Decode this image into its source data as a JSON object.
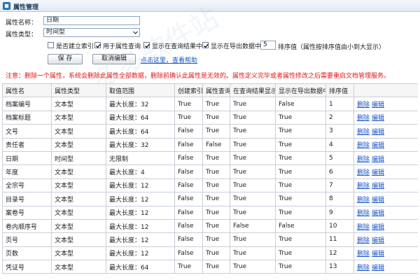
{
  "window": {
    "title": "属性管理"
  },
  "form": {
    "name_label": "属性名称：",
    "name_value": "日期",
    "type_label": "属性类型：",
    "type_value": "时间型",
    "options": [
      {
        "label": "是否建立索引",
        "checked": false
      },
      {
        "label": "用于属性查询",
        "checked": true
      },
      {
        "label": "显示在查询结果中",
        "checked": true
      },
      {
        "label": "显示在导出数据中",
        "checked": true
      }
    ],
    "order_value": "5",
    "order_label": "排序值（属性按排序值由小到大显示）",
    "save_label": "保 存",
    "cancel_label": "取消编辑",
    "help_link": "点击这里，查看帮助"
  },
  "notice": "注意：删除一个属性，系统会删除此属性全部数据，删除前确认此属性是无效的。属性定义完毕或者属性修改之后需要重启文档管理服务。",
  "table": {
    "columns": [
      "属性名",
      "属性类型",
      "取值范围",
      "创建索引",
      "属性查询",
      "在查询结果显示",
      "显示在导出数据中",
      "排序值",
      ""
    ],
    "actions": {
      "delete": "删除",
      "edit": "编辑"
    },
    "rows": [
      [
        "档案编号",
        "文本型",
        "最大长度：32",
        "True",
        "True",
        "True",
        "False",
        "1"
      ],
      [
        "档案标题",
        "文本型",
        "最大长度：64",
        "True",
        "True",
        "True",
        "True",
        "2"
      ],
      [
        "文号",
        "文本型",
        "最大长度：64",
        "False",
        "True",
        "True",
        "True",
        "3"
      ],
      [
        "责任者",
        "文本型",
        "最大长度：32",
        "False",
        "False",
        "True",
        "True",
        "4"
      ],
      [
        "日期",
        "时间型",
        "无限制",
        "False",
        "True",
        "True",
        "True",
        "5"
      ],
      [
        "年度",
        "文本型",
        "最大长度：4",
        "False",
        "True",
        "True",
        "True",
        "6"
      ],
      [
        "全宗号",
        "文本型",
        "最大长度：12",
        "False",
        "True",
        "True",
        "True",
        "7"
      ],
      [
        "目录号",
        "文本型",
        "最大长度：12",
        "False",
        "True",
        "True",
        "True",
        "8"
      ],
      [
        "案卷号",
        "文本型",
        "最大长度：12",
        "False",
        "True",
        "True",
        "True",
        "9"
      ],
      [
        "卷内顺序号",
        "文本型",
        "最大长度：12",
        "False",
        "True",
        "False",
        "False",
        "10"
      ],
      [
        "页号",
        "文本型",
        "最大长度：12",
        "False",
        "True",
        "True",
        "True",
        "11"
      ],
      [
        "页数",
        "文本型",
        "最大长度：12",
        "False",
        "True",
        "True",
        "True",
        "12"
      ],
      [
        "凭证号",
        "文本型",
        "最大长度：64",
        "True",
        "True",
        "True",
        "True",
        "13"
      ]
    ]
  },
  "watermark": "多多软件站"
}
